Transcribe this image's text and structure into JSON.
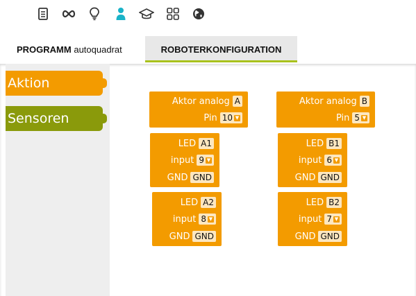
{
  "toolbar": {
    "icons": [
      "list-icon",
      "infinity-icon",
      "lightbulb-icon",
      "user-icon",
      "graduation-cap-icon",
      "grid-icon",
      "globe-icon"
    ],
    "accent": "#1ab3c8"
  },
  "tabs": {
    "program_label": "PROGRAMM",
    "program_name": "autoquadrat",
    "robot_config_label": "ROBOTERKONFIGURATION",
    "active_underline": "#a9c21c"
  },
  "categories": [
    {
      "label": "Aktion",
      "color": "#f39b00"
    },
    {
      "label": "Sensoren",
      "color": "#8a9a0b"
    }
  ],
  "blocks": {
    "actor_a": {
      "title": "Aktor analog",
      "id": "A",
      "pin_label": "Pin",
      "pin_value": "10"
    },
    "actor_b": {
      "title": "Aktor analog",
      "id": "B",
      "pin_label": "Pin",
      "pin_value": "5"
    },
    "led_a1": {
      "led_label": "LED",
      "led_id": "A1",
      "input_label": "input",
      "input_value": "9",
      "gnd_label": "GND",
      "gnd_value": "GND"
    },
    "led_a2": {
      "led_label": "LED",
      "led_id": "A2",
      "input_label": "input",
      "input_value": "8",
      "gnd_label": "GND",
      "gnd_value": "GND"
    },
    "led_b1": {
      "led_label": "LED",
      "led_id": "B1",
      "input_label": "input",
      "input_value": "6",
      "gnd_label": "GND",
      "gnd_value": "GND"
    },
    "led_b2": {
      "led_label": "LED",
      "led_id": "B2",
      "input_label": "input",
      "input_value": "7",
      "gnd_label": "GND",
      "gnd_value": "GND"
    }
  },
  "block_color": "#f39b00"
}
